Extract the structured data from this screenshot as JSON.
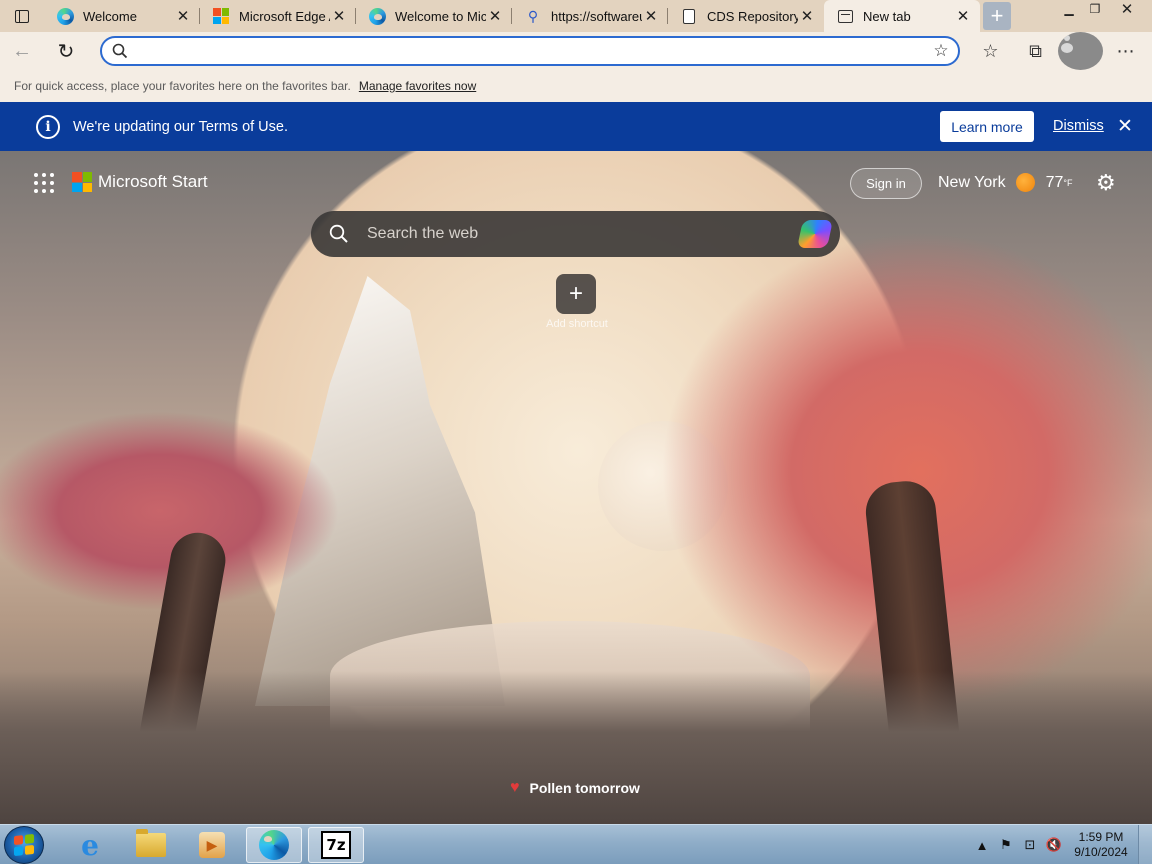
{
  "tabs": [
    {
      "title": "Welcome",
      "icon": "edge-icon",
      "active": false
    },
    {
      "title": "Microsoft Edge A",
      "icon": "microsoft-icon",
      "active": false
    },
    {
      "title": "Welcome to Mic",
      "icon": "edge-icon",
      "active": false
    },
    {
      "title": "https://softwareu",
      "icon": "search-icon",
      "active": false
    },
    {
      "title": "CDS Repository",
      "icon": "document-icon",
      "active": false
    },
    {
      "title": "New tab",
      "icon": "new-tab-icon",
      "active": true
    }
  ],
  "address_bar": {
    "value": "",
    "placeholder": ""
  },
  "favorites_bar": {
    "hint": "For quick access, place your favorites here on the favorites bar.",
    "manage_link": "Manage favorites now"
  },
  "banner": {
    "message": "We're updating our Terms of Use.",
    "learn_more": "Learn more",
    "dismiss": "Dismiss"
  },
  "start_page": {
    "brand": "Microsoft Start",
    "sign_in": "Sign in",
    "weather": {
      "city": "New York",
      "temp": "77",
      "unit": "°F"
    },
    "search_placeholder": "Search the web",
    "shortcut_label": "Add shortcut",
    "pollen": "Pollen tomorrow"
  },
  "taskbar": {
    "apps": [
      "internet-explorer",
      "file-explorer",
      "media-player",
      "microsoft-edge",
      "7-zip"
    ],
    "sevenzip_label": "7z",
    "clock": {
      "time": "1:59 PM",
      "date": "9/10/2024"
    }
  },
  "colors": {
    "banner_bg": "#0a3c9b",
    "address_border": "#2c6ad0",
    "tabstrip_bg": "#e3d3bf",
    "toolbar_bg": "#f4ede4"
  }
}
